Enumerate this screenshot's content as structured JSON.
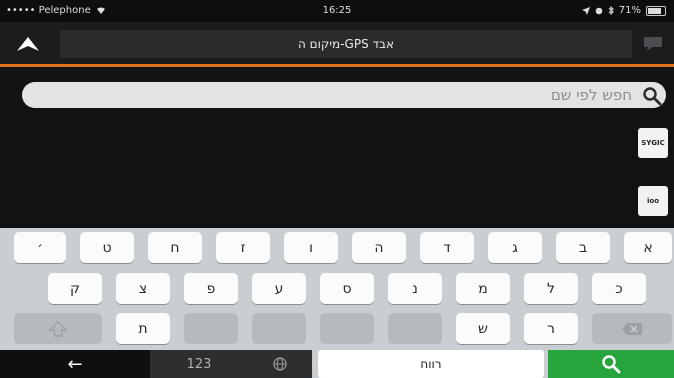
{
  "status_bar": {
    "carrier": "••••• Pelephone",
    "time": "16:25",
    "battery": "71%"
  },
  "header": {
    "title": "מיקום ה-GPS אבד"
  },
  "search": {
    "placeholder": "חפש לפי שם"
  },
  "results": [
    {
      "icon": "sygic-logo-icon",
      "logo_text": "SYGIC"
    },
    {
      "icon": "ioo-logo-icon",
      "logo_text": "ioo"
    }
  ],
  "keyboard": {
    "row1": [
      "׳",
      "ט",
      "ח",
      "ז",
      "ו",
      "ה",
      "ד",
      "ג",
      "ב",
      "א"
    ],
    "row2": [
      "ק",
      "צ",
      "פ",
      "ע",
      "ס",
      "נ",
      "מ",
      "ל",
      "כ"
    ],
    "row3": [
      "ת",
      "ש",
      "ר"
    ],
    "arrow_label": "←",
    "numbers_label": "123",
    "space_label": "רווח"
  },
  "colors": {
    "accent_orange": "#e1701c",
    "search_key_green": "#27a53c"
  }
}
